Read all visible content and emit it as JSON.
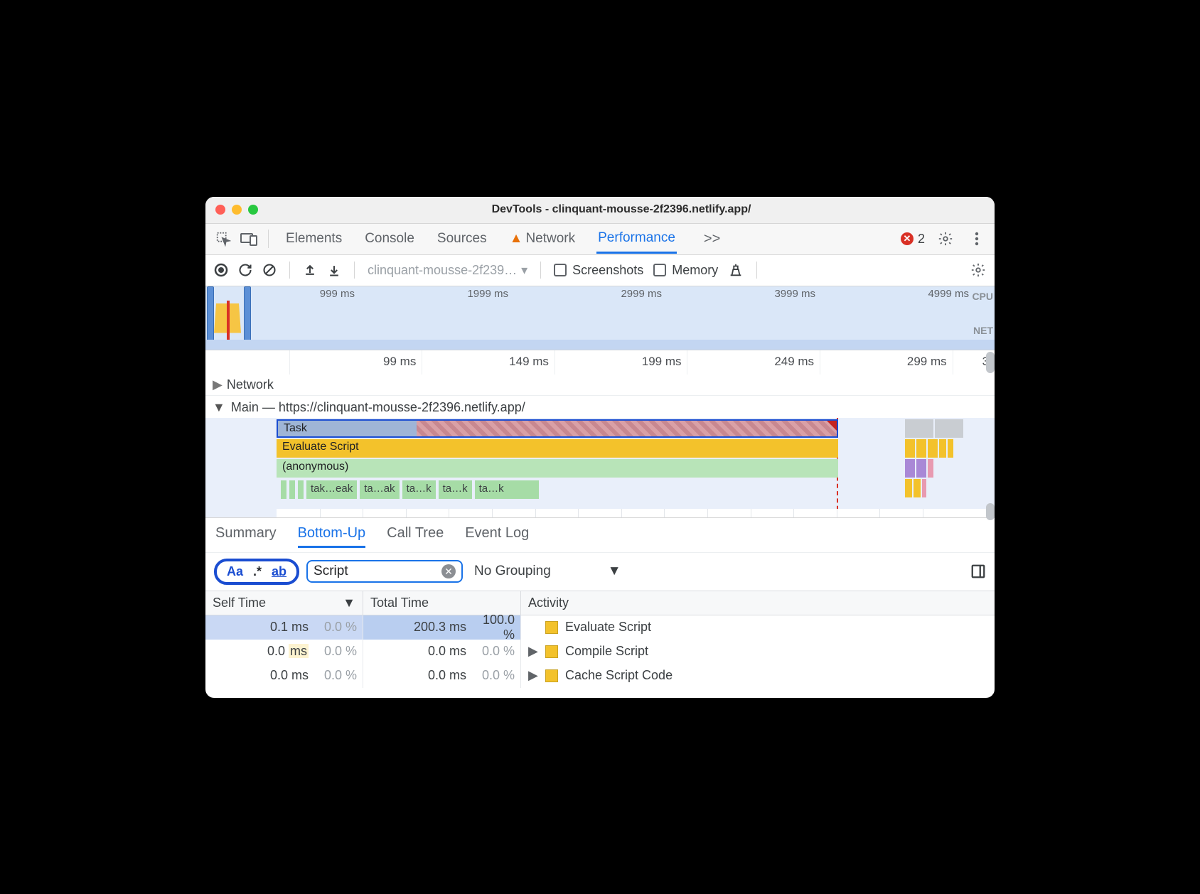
{
  "window": {
    "title": "DevTools - clinquant-mousse-2f2396.netlify.app/"
  },
  "tabs": {
    "elements": "Elements",
    "console": "Console",
    "sources": "Sources",
    "network": "Network",
    "performance": "Performance",
    "overflow": ">>",
    "error_count": "2"
  },
  "toolbar": {
    "url": "clinquant-mousse-2f239…",
    "screenshots_label": "Screenshots",
    "memory_label": "Memory"
  },
  "overview": {
    "ticks": [
      "999 ms",
      "1999 ms",
      "2999 ms",
      "3999 ms",
      "4999 ms"
    ],
    "cpu_label": "CPU",
    "net_label": "NET"
  },
  "timeline": {
    "ruler": [
      "99 ms",
      "149 ms",
      "199 ms",
      "249 ms",
      "299 ms",
      "3"
    ],
    "network_label": "Network",
    "main_label": "Main — https://clinquant-mousse-2f2396.netlify.app/",
    "task_label": "Task",
    "eval_label": "Evaluate Script",
    "anon_label": "(anonymous)",
    "micro": [
      "tak…eak",
      "ta…ak",
      "ta…k",
      "ta…k",
      "ta…k"
    ]
  },
  "detail_tabs": {
    "summary": "Summary",
    "bottom_up": "Bottom-Up",
    "call_tree": "Call Tree",
    "event_log": "Event Log"
  },
  "filter": {
    "aa": "Aa",
    "regex": ".*",
    "whole": "ab",
    "value": "Script",
    "grouping": "No Grouping"
  },
  "table": {
    "head": {
      "self": "Self Time",
      "total": "Total Time",
      "activity": "Activity"
    },
    "rows": [
      {
        "self_ms": "0.1 ms",
        "self_pct": "0.0 %",
        "total_ms": "200.3 ms",
        "total_pct": "100.0 %",
        "activity": "Evaluate Script",
        "expandable": false
      },
      {
        "self_ms": "0.0 ms",
        "self_pct": "0.0 %",
        "total_ms": "0.0 ms",
        "total_pct": "0.0 %",
        "activity": "Compile Script",
        "expandable": true
      },
      {
        "self_ms": "0.0 ms",
        "self_pct": "0.0 %",
        "total_ms": "0.0 ms",
        "total_pct": "0.0 %",
        "activity": "Cache Script Code",
        "expandable": true
      }
    ]
  }
}
